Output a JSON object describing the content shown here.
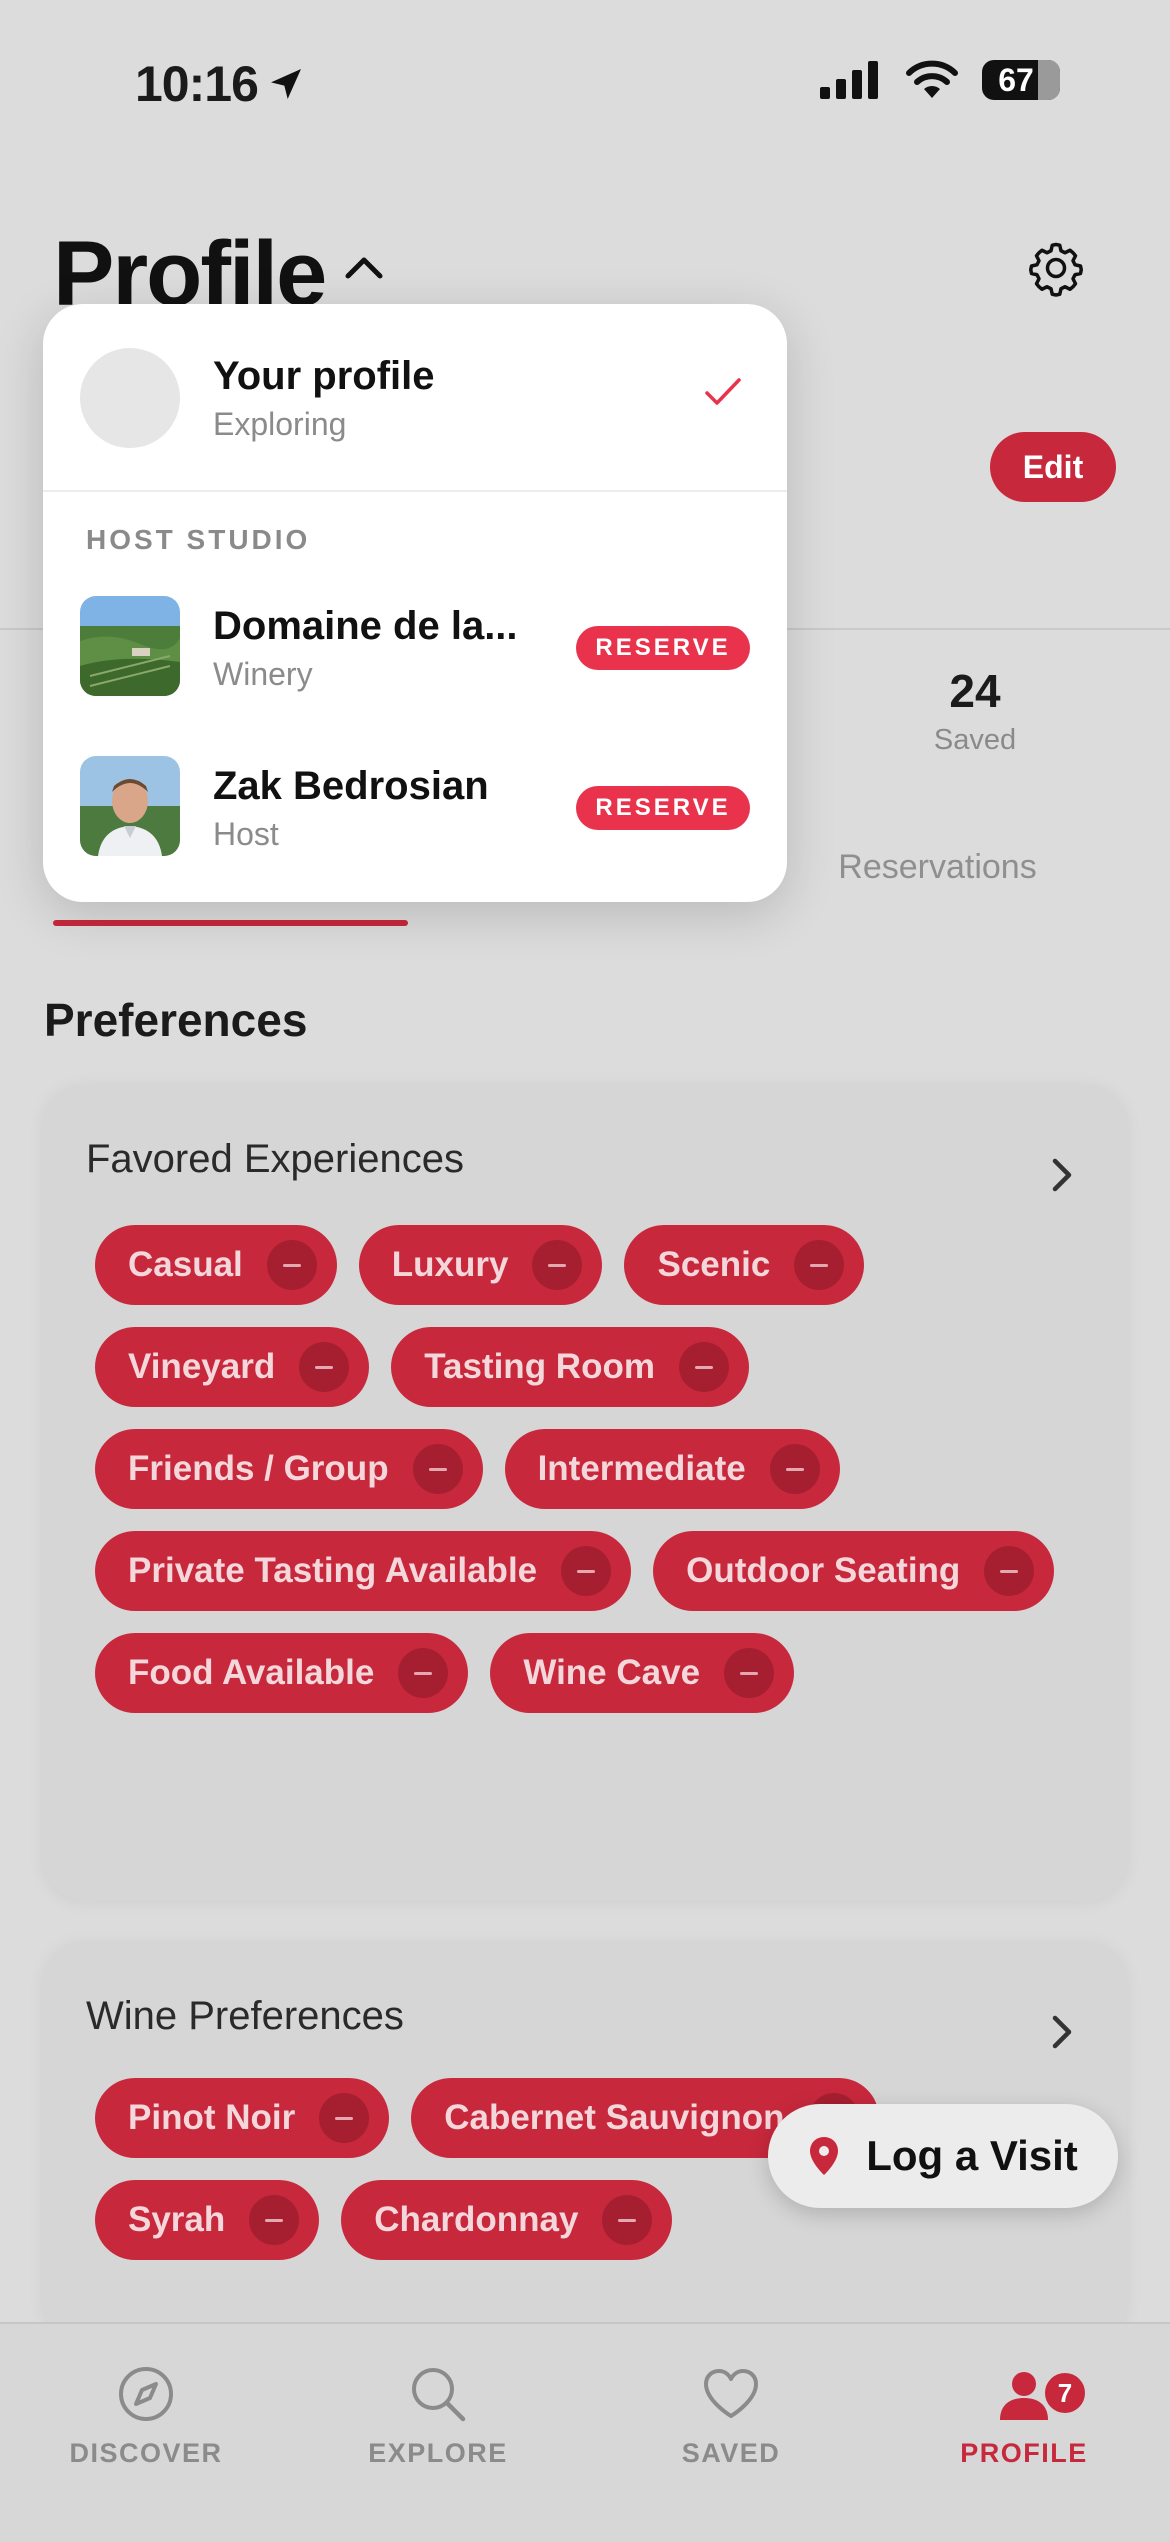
{
  "status_bar": {
    "time": "10:16",
    "battery": "67"
  },
  "header": {
    "title": "Profile",
    "edit_label": "Edit"
  },
  "stats": {
    "saved_count": "24",
    "saved_label": "Saved"
  },
  "tabs": {
    "reservations": "Reservations"
  },
  "dropdown": {
    "current": {
      "name": "Your profile",
      "subtitle": "Exploring"
    },
    "section_label": "HOST STUDIO",
    "studios": [
      {
        "name": "Domaine de la...",
        "subtitle": "Winery",
        "action": "RESERVE"
      },
      {
        "name": "Zak Bedrosian",
        "subtitle": "Host",
        "action": "RESERVE"
      }
    ]
  },
  "preferences": {
    "title": "Preferences",
    "favored": {
      "title": "Favored Experiences",
      "chips": [
        "Casual",
        "Luxury",
        "Scenic",
        "Vineyard",
        "Tasting Room",
        "Friends / Group",
        "Intermediate",
        "Private Tasting Available",
        "Outdoor Seating",
        "Food Available",
        "Wine Cave"
      ]
    },
    "wine": {
      "title": "Wine Preferences",
      "chips": [
        "Pinot Noir",
        "Cabernet Sauvignon",
        "Syrah",
        "Chardonnay"
      ]
    }
  },
  "fab": {
    "label": "Log a Visit"
  },
  "tabbar": {
    "items": [
      {
        "label": "DISCOVER",
        "icon": "compass-icon"
      },
      {
        "label": "EXPLORE",
        "icon": "search-icon"
      },
      {
        "label": "SAVED",
        "icon": "heart-icon"
      },
      {
        "label": "PROFILE",
        "icon": "profile-icon",
        "badge": "7"
      }
    ]
  },
  "colors": {
    "accent": "#c8283c",
    "reserve": "#e9334c",
    "background": "#dcdcdc"
  }
}
